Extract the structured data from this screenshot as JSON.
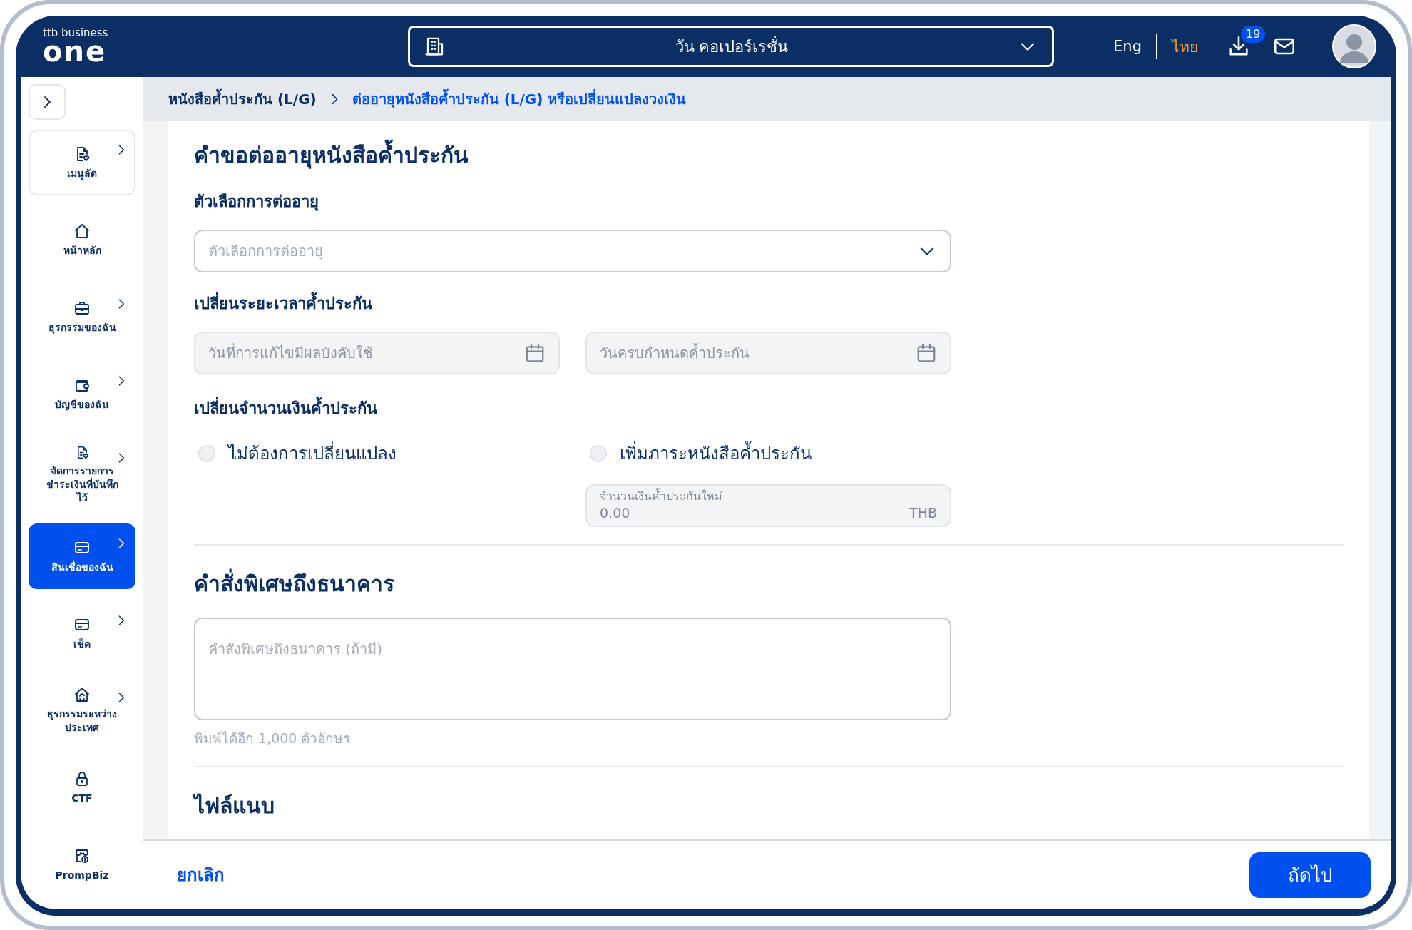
{
  "header": {
    "logo": {
      "brand": "ttb business",
      "product": "one"
    },
    "company_select": {
      "value": "วัน คอเปอร์เรชั่น"
    },
    "languages": [
      {
        "label": "Eng",
        "selected": false
      },
      {
        "label": "ไทย",
        "selected": true
      }
    ],
    "downloads_badge": "19"
  },
  "sidebar": {
    "items": [
      {
        "label": "เมนูลัด",
        "kind": "shortcut",
        "submenu": true,
        "selected": false
      },
      {
        "label": "หน้าหลัก",
        "kind": "nav",
        "submenu": false,
        "selected": false
      },
      {
        "label": "ธุรกรรมของฉัน",
        "kind": "nav",
        "submenu": true,
        "selected": false
      },
      {
        "label": "บัญชีของฉัน",
        "kind": "nav",
        "submenu": true,
        "selected": false
      },
      {
        "label": "จัดการรายการชำระเงินที่บันทึกไว้",
        "kind": "nav",
        "submenu": true,
        "selected": false
      },
      {
        "label": "สินเชื่อของฉัน",
        "kind": "nav",
        "submenu": true,
        "selected": true
      },
      {
        "label": "เช็ค",
        "kind": "nav",
        "submenu": true,
        "selected": false
      },
      {
        "label": "ธุรกรรมระหว่างประเทศ",
        "kind": "nav",
        "submenu": true,
        "selected": false
      },
      {
        "label": "CTF",
        "kind": "nav",
        "submenu": false,
        "selected": false
      },
      {
        "label": "PrompBiz",
        "kind": "nav",
        "submenu": false,
        "selected": false
      }
    ]
  },
  "breadcrumb": [
    {
      "label": "หนังสือค้ำประกัน (L/G)",
      "current": false
    },
    {
      "label": "ต่ออายุหนังสือค้ำประกัน (L/G) หรือเปลี่ยนแปลงวงเงิน",
      "current": true
    }
  ],
  "form": {
    "title": "คำขอต่ออายุหนังสือค้ำประกัน",
    "renewal_option": {
      "label": "ตัวเลือกการต่ออายุ",
      "placeholder": "ตัวเลือกการต่ออายุ"
    },
    "period": {
      "label": "เปลี่ยนระยะเวลาค้ำประกัน",
      "fields": [
        {
          "placeholder": "วันที่การแก้ไขมีผลบังคับใช้"
        },
        {
          "placeholder": "วันครบกำหนดค้ำประกัน"
        }
      ]
    },
    "amount": {
      "label": "เปลี่ยนจำนวนเงินค้ำประกัน",
      "options": [
        {
          "label": "ไม่ต้องการเปลี่ยนแปลง",
          "selected": false
        },
        {
          "label": "เพิ่มภาระหนังสือค้ำประกัน",
          "selected": false
        }
      ],
      "new_amount": {
        "label": "จำนวนเงินค้ำประกันใหม่",
        "value": "0.00",
        "unit": "THB"
      }
    },
    "instructions": {
      "title": "คำสั่งพิเศษถึงธนาคาร",
      "placeholder": "คำสั่งพิเศษถึงธนาคาร (ถ้ามี)",
      "helper": "พิมพ์ได้อีก 1,000 ตัวอักษร"
    },
    "attachments": {
      "title": "ไฟล์แนบ"
    }
  },
  "footer": {
    "cancel": "ยกเลิก",
    "next": "ถัดไป"
  }
}
